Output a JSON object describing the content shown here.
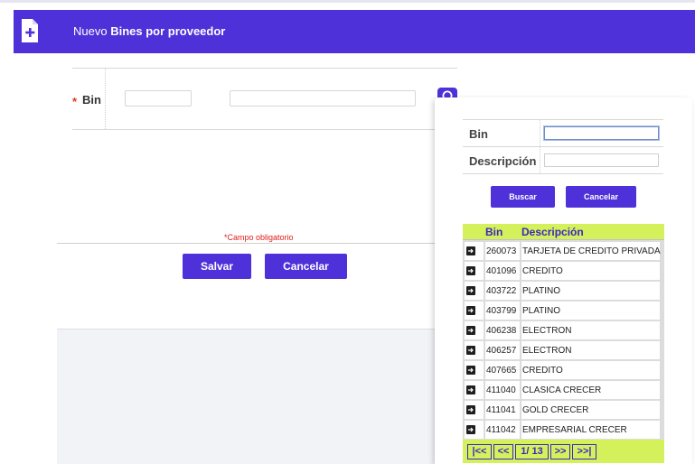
{
  "header": {
    "prefix": "Nuevo",
    "title": "Bines por proveedor",
    "icon": "file-add-icon",
    "color": "#4e31d9"
  },
  "form": {
    "required_mark": "*",
    "bin_label": "Bin",
    "bin_value": "",
    "description_value": "",
    "required_note": "*Campo obligatorio",
    "save_label": "Salvar",
    "cancel_label": "Cancelar"
  },
  "popup": {
    "filters": {
      "bin_label": "Bin",
      "bin_value": "",
      "description_label": "Descripción",
      "description_value": ""
    },
    "search_label": "Buscar",
    "cancel_label": "Cancelar",
    "grid": {
      "columns": [
        "Bin",
        "Descripción"
      ],
      "header_color": "#d4f15c",
      "rows": [
        {
          "bin": "260073",
          "description": "TARJETA DE CREDITO PRIVADA"
        },
        {
          "bin": "401096",
          "description": "CREDITO"
        },
        {
          "bin": "403722",
          "description": "PLATINO"
        },
        {
          "bin": "403799",
          "description": "PLATINO"
        },
        {
          "bin": "406238",
          "description": "ELECTRON"
        },
        {
          "bin": "406257",
          "description": "ELECTRON"
        },
        {
          "bin": "407665",
          "description": "CREDITO"
        },
        {
          "bin": "411040",
          "description": "CLASICA CRECER"
        },
        {
          "bin": "411041",
          "description": "GOLD CRECER"
        },
        {
          "bin": "411042",
          "description": "EMPRESARIAL CRECER"
        }
      ]
    },
    "pager": {
      "first": "|<<",
      "prev": "<<",
      "page": "1/ 13",
      "next": ">>",
      "last": ">>|"
    }
  }
}
